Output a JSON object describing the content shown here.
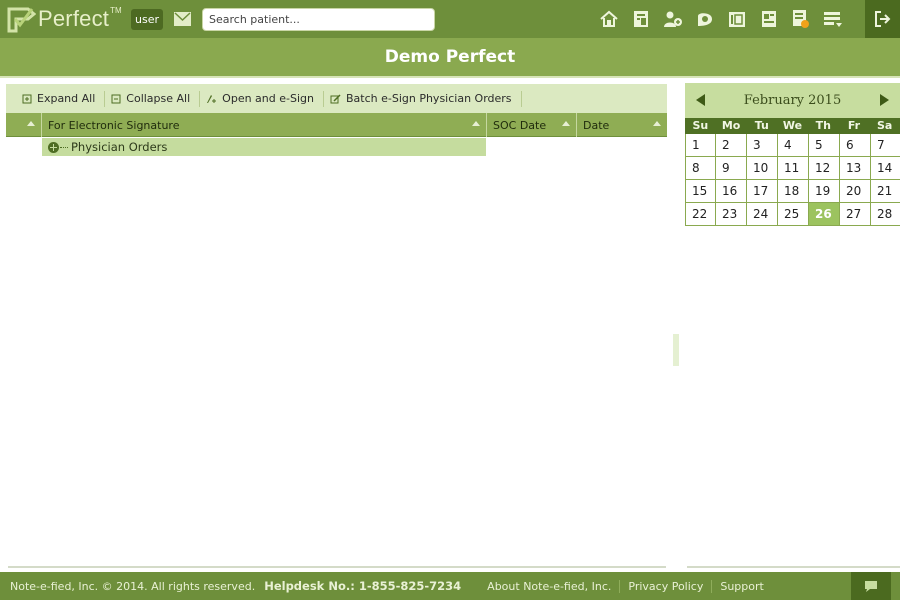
{
  "header": {
    "logo_text": "Perfect",
    "logo_tm": "TM",
    "user_label": "user",
    "search_placeholder": "Search patient...",
    "nav_icons": [
      "home-icon",
      "patient-chart-icon",
      "add-patient-icon",
      "document-icon",
      "oasis-icon",
      "schedule-icon",
      "orders-badge-icon",
      "menu-dropdown-icon"
    ],
    "logout_icon": "logout-icon"
  },
  "page": {
    "title": "Demo Perfect"
  },
  "toolbar": {
    "expand_all": "Expand All",
    "collapse_all": "Collapse All",
    "open_esign": "Open and e-Sign",
    "batch_esign": "Batch e-Sign Physician Orders"
  },
  "grid": {
    "columns": [
      "For Electronic Signature",
      "SOC Date",
      "Date"
    ],
    "rows": [
      {
        "label": "Physician Orders",
        "soc_date": "",
        "date": ""
      }
    ]
  },
  "calendar": {
    "month_label": "February 2015",
    "weekdays": [
      "Su",
      "Mo",
      "Tu",
      "We",
      "Th",
      "Fr",
      "Sa"
    ],
    "days": [
      1,
      2,
      3,
      4,
      5,
      6,
      7,
      8,
      9,
      10,
      11,
      12,
      13,
      14,
      15,
      16,
      17,
      18,
      19,
      20,
      21,
      22,
      23,
      24,
      25,
      26,
      27,
      28
    ],
    "selected_day": 26
  },
  "footer": {
    "copyright": "Note-e-fied, Inc. © 2014. All rights reserved.",
    "helpdesk": "Helpdesk No.: 1-855-825-7234",
    "links": [
      "About Note-e-fied, Inc.",
      "Privacy Policy",
      "Support"
    ]
  },
  "colors": {
    "header_green": "#6e8f3b",
    "title_green": "#8aa94f",
    "accent_light": "#c7dd9f",
    "today_highlight": "#9cc35f"
  }
}
